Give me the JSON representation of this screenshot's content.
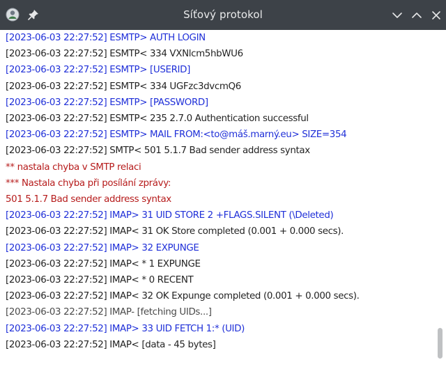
{
  "window": {
    "title": "Síťový protokol",
    "titlebar_color": "#3d4248",
    "icons": {
      "app": "app-avatar-icon",
      "pin": "pin-icon",
      "minimize": "chevron-down-icon",
      "maximize": "chevron-up-icon",
      "close": "close-icon"
    }
  },
  "colors": {
    "outgoing": "#1f2fd8",
    "incoming": "#232323",
    "error": "#b61b1b"
  },
  "log": [
    {
      "text": "[2023-06-03 22:27:52] ESMTP> AUTH LOGIN",
      "kind": "blue"
    },
    {
      "text": "[2023-06-03 22:27:52] ESMTP< 334 VXNlcm5hbWU6",
      "kind": "black"
    },
    {
      "text": "[2023-06-03 22:27:52] ESMTP> [USERID]",
      "kind": "blue"
    },
    {
      "text": "[2023-06-03 22:27:52] ESMTP< 334 UGFzc3dvcmQ6",
      "kind": "black"
    },
    {
      "text": "[2023-06-03 22:27:52] ESMTP> [PASSWORD]",
      "kind": "blue"
    },
    {
      "text": "[2023-06-03 22:27:52] ESMTP< 235 2.7.0 Authentication successful",
      "kind": "black"
    },
    {
      "text": "[2023-06-03 22:27:52] ESMTP> MAIL FROM:<to@máš.marný.eu> SIZE=354",
      "kind": "blue"
    },
    {
      "text": "[2023-06-03 22:27:52] SMTP< 501 5.1.7 Bad sender address syntax",
      "kind": "black"
    },
    {
      "text": "** nastala chyba v SMTP relaci",
      "kind": "red"
    },
    {
      "text": "*** Nastala chyba při posílání zprávy:",
      "kind": "red"
    },
    {
      "text": "501 5.1.7 Bad sender address syntax",
      "kind": "red"
    },
    {
      "text": "[2023-06-03 22:27:52] IMAP> 31 UID STORE 2 +FLAGS.SILENT (\\Deleted)",
      "kind": "blue"
    },
    {
      "text": "[2023-06-03 22:27:52] IMAP< 31 OK Store completed (0.001 + 0.000 secs).",
      "kind": "black"
    },
    {
      "text": "[2023-06-03 22:27:52] IMAP> 32 EXPUNGE",
      "kind": "blue"
    },
    {
      "text": "[2023-06-03 22:27:52] IMAP< * 1 EXPUNGE",
      "kind": "black"
    },
    {
      "text": "[2023-06-03 22:27:52] IMAP< * 0 RECENT",
      "kind": "black"
    },
    {
      "text": "[2023-06-03 22:27:52] IMAP< 32 OK Expunge completed (0.001 + 0.000 secs).",
      "kind": "black"
    },
    {
      "text": "[2023-06-03 22:27:52] IMAP- [fetching UIDs...]",
      "kind": "gray"
    },
    {
      "text": "[2023-06-03 22:27:52] IMAP> 33 UID FETCH 1:* (UID)",
      "kind": "blue"
    },
    {
      "text": "[2023-06-03 22:27:52] IMAP< [data - 45 bytes]",
      "kind": "black"
    }
  ]
}
